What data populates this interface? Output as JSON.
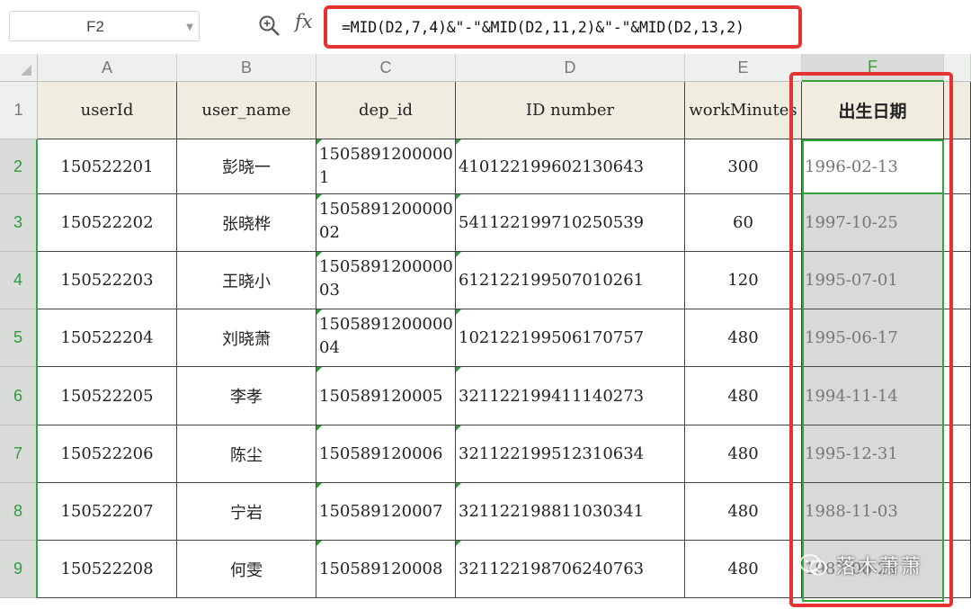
{
  "toolbar": {
    "name_box": "F2",
    "fx_label": "fx",
    "formula": "=MID(D2,7,4)&\"-\"&MID(D2,11,2)&\"-\"&MID(D2,13,2)"
  },
  "columns": [
    "A",
    "B",
    "C",
    "D",
    "E",
    "F"
  ],
  "rows": [
    "1",
    "2",
    "3",
    "4",
    "5",
    "6",
    "7",
    "8",
    "9"
  ],
  "headers": [
    "userId",
    "user_name",
    "dep_id",
    "ID number",
    "workMinutes",
    "出生日期"
  ],
  "data": [
    [
      "150522201",
      "彭晓一",
      "15058912000001",
      "410122199602130643",
      "300",
      "1996-02-13"
    ],
    [
      "150522202",
      "张晓桦",
      "150589120000002",
      "541122199710250539",
      "60",
      "1997-10-25"
    ],
    [
      "150522203",
      "王晓小",
      "150589120000003",
      "612122199507010261",
      "120",
      "1995-07-01"
    ],
    [
      "150522204",
      "刘晓萧",
      "150589120000004",
      "102122199506170757",
      "480",
      "1995-06-17"
    ],
    [
      "150522205",
      "李孝",
      "150589120005",
      "321122199411140273",
      "480",
      "1994-11-14"
    ],
    [
      "150522206",
      "陈尘",
      "150589120006",
      "321122199512310634",
      "480",
      "1995-12-31"
    ],
    [
      "150522207",
      "宁岩",
      "150589120007",
      "321122198811030341",
      "480",
      "1988-11-03"
    ],
    [
      "150522208",
      "何雯",
      "150589120008",
      "321122198706240763",
      "480",
      "1987-06-24"
    ]
  ],
  "watermark": "落木萧萧",
  "colors": {
    "highlight_red": "#e53232",
    "selection_green": "#2fa93a",
    "header_fill": "#f0ece0",
    "selected_fill": "#d9d9d9"
  }
}
